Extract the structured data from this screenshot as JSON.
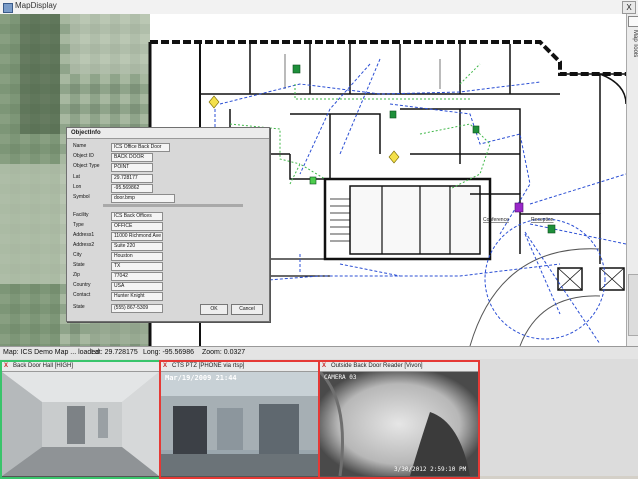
{
  "window": {
    "title": "MapDisplay",
    "close_label": "X"
  },
  "side_panel": {
    "label": "Map Tools"
  },
  "status": {
    "map": "Map: ICS Demo Map ... loaded",
    "lat": "Lat: 29.728175",
    "long": "Long: -95.56986",
    "zoom": "Zoom: 0.0327"
  },
  "map": {
    "labels": [
      "Conference",
      "Reception"
    ]
  },
  "object_info": {
    "title": "ObjectInfo",
    "fields": [
      {
        "label": "Name",
        "value": "ICS Office Back Door"
      },
      {
        "label": "Object ID",
        "value": "BACK DOOR"
      },
      {
        "label": "Object Type",
        "value": "POINT"
      },
      {
        "label": "Lat",
        "value": "29.728177"
      },
      {
        "label": "Lon",
        "value": "-95.569862"
      },
      {
        "label": "Symbol",
        "value": "door.bmp"
      },
      {
        "label": "Facility",
        "value": "ICS Back Offices"
      },
      {
        "label": "Type",
        "value": "OFFICE"
      },
      {
        "label": "Address1",
        "value": "11000 Richmond Ave"
      },
      {
        "label": "Address2",
        "value": "Suite 220"
      },
      {
        "label": "City",
        "value": "Houston"
      },
      {
        "label": "State",
        "value": "TX"
      },
      {
        "label": "Zip",
        "value": "77042"
      },
      {
        "label": "Country",
        "value": "USA"
      },
      {
        "label": "Contact",
        "value": "Hunter Knight"
      },
      {
        "label": "State",
        "value": "(555) 867-5309"
      }
    ],
    "ok_label": "OK",
    "cancel_label": "Cancel"
  },
  "cameras": [
    {
      "close": "X",
      "label": "Back Door Hall [HIGH]",
      "overlay": ""
    },
    {
      "close": "X",
      "label": "CTS PTZ [PHONE via rtsp]",
      "overlay": "Mar/19/2009 21:44"
    },
    {
      "close": "X",
      "label": "Outside Back Door Reader [Vivon]",
      "overlay_top": "CAMERA 03",
      "overlay": "3/30/2012 2:59:10 PM"
    }
  ],
  "colors": {
    "accent_green": "#39c46b",
    "camera_border_red": "#e53935",
    "dashed_blue": "#2b4fd4",
    "dashed_green": "#41b84a"
  }
}
